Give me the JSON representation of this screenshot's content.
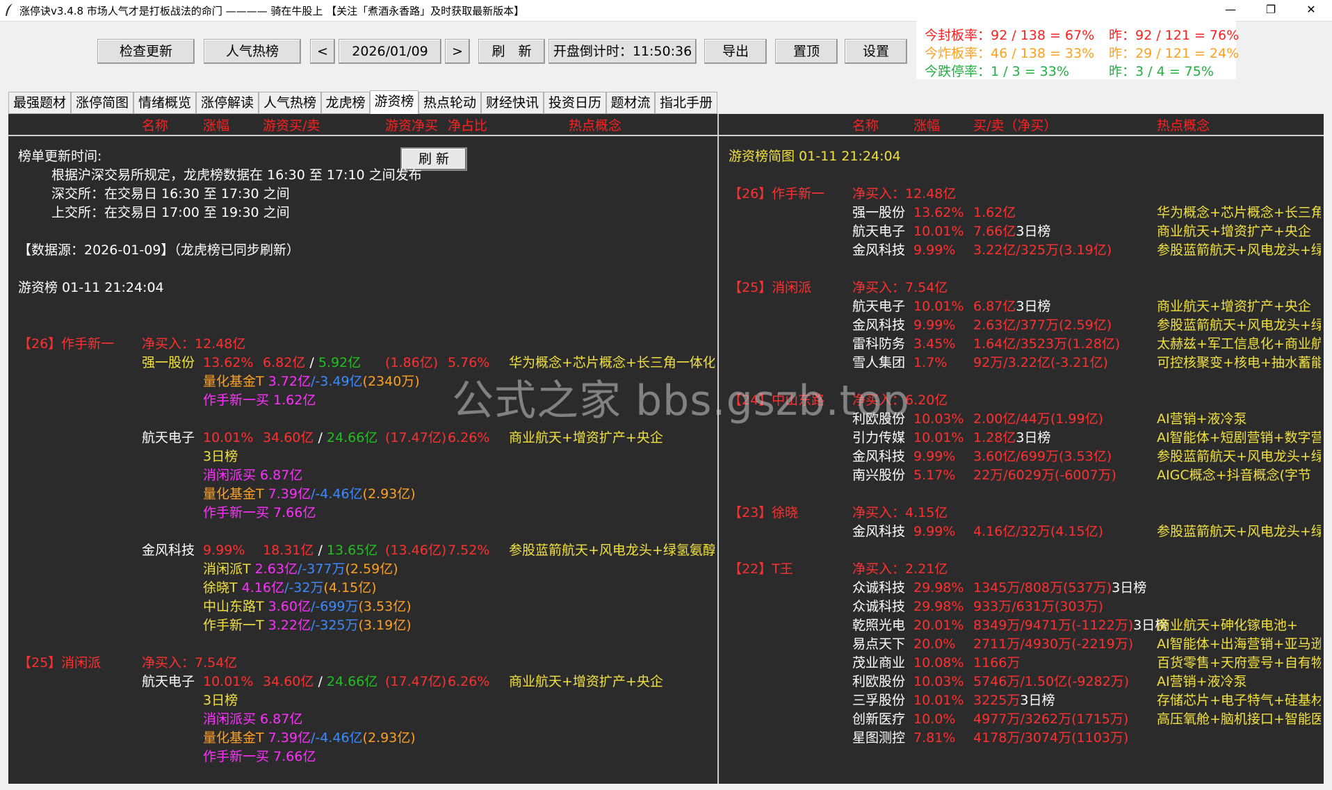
{
  "window": {
    "title": "涨停诀v3.4.8 市场人气才是打板战法的命门 ———— 骑在牛股上 【关注「煮酒永香路」及时获取最新版本】",
    "minimize": "—",
    "maximize": "❐",
    "close": "✕"
  },
  "toolbar": {
    "check_update": "检查更新",
    "popular": "人气热榜",
    "prev": "<",
    "date": "2026/01/09",
    "next": ">",
    "refresh": "刷　新",
    "countdown": "开盘倒计时：11:50:36",
    "export": "导出",
    "pin": "置顶",
    "settings": "设置"
  },
  "stats": {
    "seal_today": "今封板率：92 / 138 = 67%",
    "seal_yest": "昨：92 / 121 = 76%",
    "burst_today": "今炸板率：46 / 138 = 33%",
    "burst_yest": "昨：29 / 121 = 24%",
    "limitdown_today": "今跌停率：1 / 3 = 33%",
    "limitdown_yest": "昨：3 / 4 = 75%",
    "colors": {
      "seal": "#ff2020",
      "burst": "#ffa020",
      "limitdown": "#20b040"
    }
  },
  "tabs": [
    "最强题材",
    "涨停简图",
    "情绪概览",
    "涨停解读",
    "人气热榜",
    "龙虎榜",
    "游资榜",
    "热点轮动",
    "财经快讯",
    "投资日历",
    "题材流",
    "指北手册"
  ],
  "active_tab": "游资榜",
  "left": {
    "headers": [
      "名称",
      "涨幅",
      "游资买/卖",
      "游资净买",
      "净占比",
      "热点概念"
    ],
    "refresh_label": "刷 新",
    "update_time_label": "榜单更新时间:",
    "notice1": "根据沪深交易所规定，龙虎榜数据在 16:30 至 17:10 之间发布",
    "notice2": "深交所：在交易日 16:30 至 17:30 之间",
    "notice3": "上交所：在交易日 17:00 至 19:30 之间",
    "source": "【数据源：2026-01-09】（龙虎榜已同步刷新）",
    "list_title": "游资榜 01-11 21:24:04",
    "g26_name": "【26】作手新一",
    "g26_net": "净买入：12.48亿",
    "s1_name": "强一股份",
    "s1_pct": "13.62%",
    "s1_buy": "6.82亿",
    "s1_slash": "/",
    "s1_sell": "5.92亿",
    "s1_net": "(1.86亿)",
    "s1_ratio": "5.76%",
    "s1_concept": "华为概念+芯片概念+长三角一体化",
    "s1_q_label": "量化基金T",
    "s1_q_buy": "3.72亿",
    "s1_q_sell": "/-3.49亿",
    "s1_q_net": "(2340万)",
    "s1_zs": "作手新一买 1.62亿",
    "s2_name": "航天电子",
    "s2_pct": "10.01%",
    "s2_buy": "34.60亿",
    "s2_slash": "/",
    "s2_sell": "24.66亿",
    "s2_net": "(17.47亿)",
    "s2_ratio": "6.26%",
    "s2_concept": "商业航天+增资扩产+央企",
    "s2_3d": "3日榜",
    "s2_xx": "消闲派买 6.87亿",
    "s2_q_label": "量化基金T",
    "s2_q_buy": "7.39亿",
    "s2_q_sell": "/-4.46亿",
    "s2_q_net": "(2.93亿)",
    "s2_zs": "作手新一买 7.66亿",
    "s3_name": "金风科技",
    "s3_pct": "9.99%",
    "s3_buy": "18.31亿",
    "s3_slash": "/",
    "s3_sell": "13.65亿",
    "s3_net": "(13.46亿)",
    "s3_ratio": "7.52%",
    "s3_concept": "参股蓝箭航天+风电龙头+绿氢氨醇",
    "s3_l1_label": "消闲派T",
    "s3_l1_buy": "2.63亿",
    "s3_l1_sell": "/-377万",
    "s3_l1_net": "(2.59亿)",
    "s3_l2_label": "徐晓T",
    "s3_l2_buy": "4.16亿",
    "s3_l2_sell": "/-32万",
    "s3_l2_net": "(4.15亿)",
    "s3_l3_label": "中山东路T",
    "s3_l3_buy": "3.60亿",
    "s3_l3_sell": "/-699万",
    "s3_l3_net": "(3.53亿)",
    "s3_l4_label": "作手新一T",
    "s3_l4_buy": "3.22亿",
    "s3_l4_sell": "/-325万",
    "s3_l4_net": "(3.19亿)",
    "g25_name": "【25】消闲派",
    "g25_net": "净买入：7.54亿",
    "s4_name": "航天电子",
    "s4_pct": "10.01%",
    "s4_buy": "34.60亿",
    "s4_slash": "/",
    "s4_sell": "24.66亿",
    "s4_net": "(17.47亿)",
    "s4_ratio": "6.26%",
    "s4_concept": "商业航天+增资扩产+央企",
    "s4_3d": "3日榜",
    "s4_xx": "消闲派买 6.87亿",
    "s4_q_label": "量化基金T",
    "s4_q_buy": "7.39亿",
    "s4_q_sell": "/-4.46亿",
    "s4_q_net": "(2.93亿)",
    "s4_zs": "作手新一买 7.66亿"
  },
  "right": {
    "headers": [
      "名称",
      "涨幅",
      "买/卖（净买）",
      "热点概念"
    ],
    "title": "游资榜简图 01-11 21:24:04",
    "groups": [
      {
        "name": "【26】作手新一",
        "net": "净买入：12.48亿",
        "rows": [
          {
            "name": "强一股份",
            "pct": "13.62%",
            "bs": "1.62亿",
            "extra": "",
            "concept": "华为概念+芯片概念+长三角"
          },
          {
            "name": "航天电子",
            "pct": "10.01%",
            "bs": "7.66亿",
            "extra": "3日榜",
            "concept": "商业航天+增资扩产+央企"
          },
          {
            "name": "金风科技",
            "pct": "9.99%",
            "bs": "3.22亿/325万(3.19亿)",
            "extra": "",
            "concept": "参股蓝箭航天+风电龙头+绿"
          }
        ]
      },
      {
        "name": "【25】消闲派",
        "net": "净买入：7.54亿",
        "rows": [
          {
            "name": "航天电子",
            "pct": "10.01%",
            "bs": "6.87亿",
            "extra": "3日榜",
            "concept": "商业航天+增资扩产+央企"
          },
          {
            "name": "金风科技",
            "pct": "9.99%",
            "bs": "2.63亿/377万(2.59亿)",
            "extra": "",
            "concept": "参股蓝箭航天+风电龙头+绿"
          },
          {
            "name": "雷科防务",
            "pct": "3.45%",
            "bs": "1.64亿/3523万(1.28亿)",
            "extra": "",
            "concept": "太赫兹+军工信息化+商业航"
          },
          {
            "name": "雪人集团",
            "pct": "1.7%",
            "bs": "92万/3.22亿(-3.21亿)",
            "extra": "",
            "concept": "可控核聚变+核电+抽水蓄能"
          }
        ]
      },
      {
        "name": "【24】中山东路",
        "net": "净买入：6.20亿",
        "rows": [
          {
            "name": "利欧股份",
            "pct": "10.03%",
            "bs": "2.00亿/44万(1.99亿)",
            "extra": "",
            "concept": "AI营销+液冷泵"
          },
          {
            "name": "引力传媒",
            "pct": "10.01%",
            "bs": "1.28亿",
            "extra": "3日榜",
            "concept": "AI智能体+短剧营销+数字营"
          },
          {
            "name": "金风科技",
            "pct": "9.99%",
            "bs": "3.60亿/699万(3.53亿)",
            "extra": "",
            "concept": "参股蓝箭航天+风电龙头+绿"
          },
          {
            "name": "南兴股份",
            "pct": "5.17%",
            "bs": "22万/6029万(-6007万)",
            "extra": "",
            "concept": "AIGC概念+抖音概念(字节"
          }
        ]
      },
      {
        "name": "【23】徐晓",
        "net": "净买入：4.15亿",
        "rows": [
          {
            "name": "金风科技",
            "pct": "9.99%",
            "bs": "4.16亿/32万(4.15亿)",
            "extra": "",
            "concept": "参股蓝箭航天+风电龙头+绿"
          }
        ]
      },
      {
        "name": "【22】T王",
        "net": "净买入：2.21亿",
        "rows": [
          {
            "name": "众诚科技",
            "pct": "29.98%",
            "bs": "1345万/808万(537万)",
            "extra": "3日榜",
            "concept": ""
          },
          {
            "name": "众诚科技",
            "pct": "29.98%",
            "bs": "933万/631万(303万)",
            "extra": "",
            "concept": ""
          },
          {
            "name": "乾照光电",
            "pct": "20.01%",
            "bs": "8349万/9471万(-1122万)",
            "extra": "3日榜",
            "concept": "商业航天+砷化镓电池+"
          },
          {
            "name": "易点天下",
            "pct": "20.0%",
            "bs": "2711万/4930万(-2219万)",
            "extra": "",
            "concept": "AI智能体+出海营销+亚马逊"
          },
          {
            "name": "茂业商业",
            "pct": "10.08%",
            "bs": "1166万",
            "extra": "",
            "concept": "百货零售+天府壹号+自有物"
          },
          {
            "name": "利欧股份",
            "pct": "10.03%",
            "bs": "5746万/1.50亿(-9282万)",
            "extra": "",
            "concept": "AI营销+液冷泵"
          },
          {
            "name": "三孚股份",
            "pct": "10.01%",
            "bs": "3225万",
            "extra": "3日榜",
            "concept": "存储芯片+电子特气+硅基材"
          },
          {
            "name": "创新医疗",
            "pct": "10.0%",
            "bs": "4977万/3262万(1715万)",
            "extra": "",
            "concept": "高压氧舱+脑机接口+智能医"
          },
          {
            "name": "星图测控",
            "pct": "7.81%",
            "bs": "4178万/3074万(1103万)",
            "extra": "",
            "concept": ""
          }
        ]
      }
    ]
  },
  "watermark": "公式之家 bbs.gszb.top"
}
